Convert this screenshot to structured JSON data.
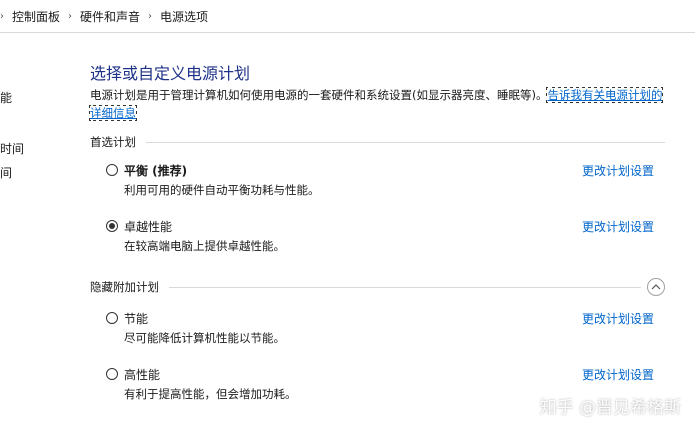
{
  "breadcrumb": {
    "items": [
      "控制面板",
      "硬件和声音",
      "电源选项"
    ],
    "separator": "›"
  },
  "leftnav": {
    "items": [
      "能",
      "时间",
      "间"
    ]
  },
  "main": {
    "title": "选择或自定义电源计划",
    "description": "电源计划是用于管理计算机如何使用电源的一套硬件和系统设置(如显示器亮度、睡眠等)。",
    "description_link": "告诉我有关电源计划的详细信息"
  },
  "sections": {
    "preferred": {
      "label": "首选计划",
      "plans": [
        {
          "name": "平衡 (推荐)",
          "desc": "利用可用的硬件自动平衡功耗与性能。",
          "selected": false,
          "change": "更改计划设置"
        },
        {
          "name": "卓越性能",
          "desc": "在较高端电脑上提供卓越性能。",
          "selected": true,
          "change": "更改计划设置"
        }
      ]
    },
    "hidden": {
      "label": "隐藏附加计划",
      "collapse_icon": "chevron-up-icon",
      "plans": [
        {
          "name": "节能",
          "desc": "尽可能降低计算机性能以节能。",
          "selected": false,
          "change": "更改计划设置"
        },
        {
          "name": "高性能",
          "desc": "有利于提高性能，但会增加功耗。",
          "selected": false,
          "change": "更改计划设置"
        }
      ]
    }
  },
  "watermark": "知乎 @晋见希格斯",
  "colors": {
    "title": "#1e3287",
    "link": "#0066cc"
  }
}
